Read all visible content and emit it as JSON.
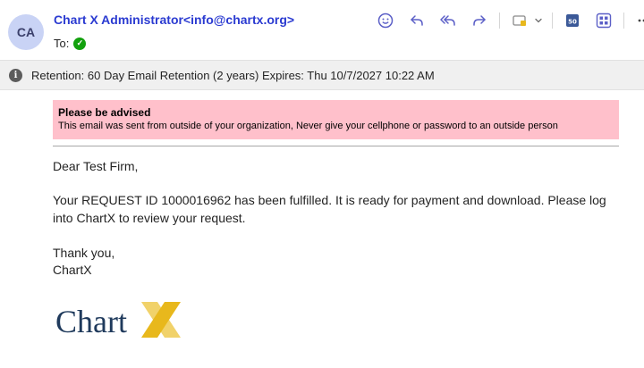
{
  "header": {
    "avatar_initials": "CA",
    "sender": "Chart X Administrator<info@chartx.org>",
    "to_label": "To:"
  },
  "toolbar": {
    "icons": [
      "emoji-icon",
      "reply-icon",
      "reply-all-icon",
      "forward-icon",
      "apps-icon",
      "chevron-down-icon",
      "calendar-icon",
      "grid-icon",
      "more-icon"
    ]
  },
  "retention": {
    "text": "Retention: 60 Day Email Retention (2 years) Expires: Thu 10/7/2027 10:22 AM"
  },
  "advisory": {
    "title": "Please be advised",
    "text": "This email was sent from outside of your organization, Never give your cellphone or password to an outside person",
    "color": "#ffc0cb"
  },
  "message": {
    "greeting": "Dear Test Firm,",
    "paragraph": "Your REQUEST ID 1000016962 has been fulfilled. It is ready for payment and download. Please log into ChartX to review your request.",
    "closing": "Thank you,",
    "signature": "ChartX"
  },
  "logo": {
    "text": "Chart",
    "mark": "X",
    "colors": {
      "text": "#1f3a5c",
      "mark": "#e8b81c"
    }
  },
  "colors": {
    "accent": "#5b5fc7",
    "sender": "#2b3bd1",
    "check": "#13a10e"
  }
}
